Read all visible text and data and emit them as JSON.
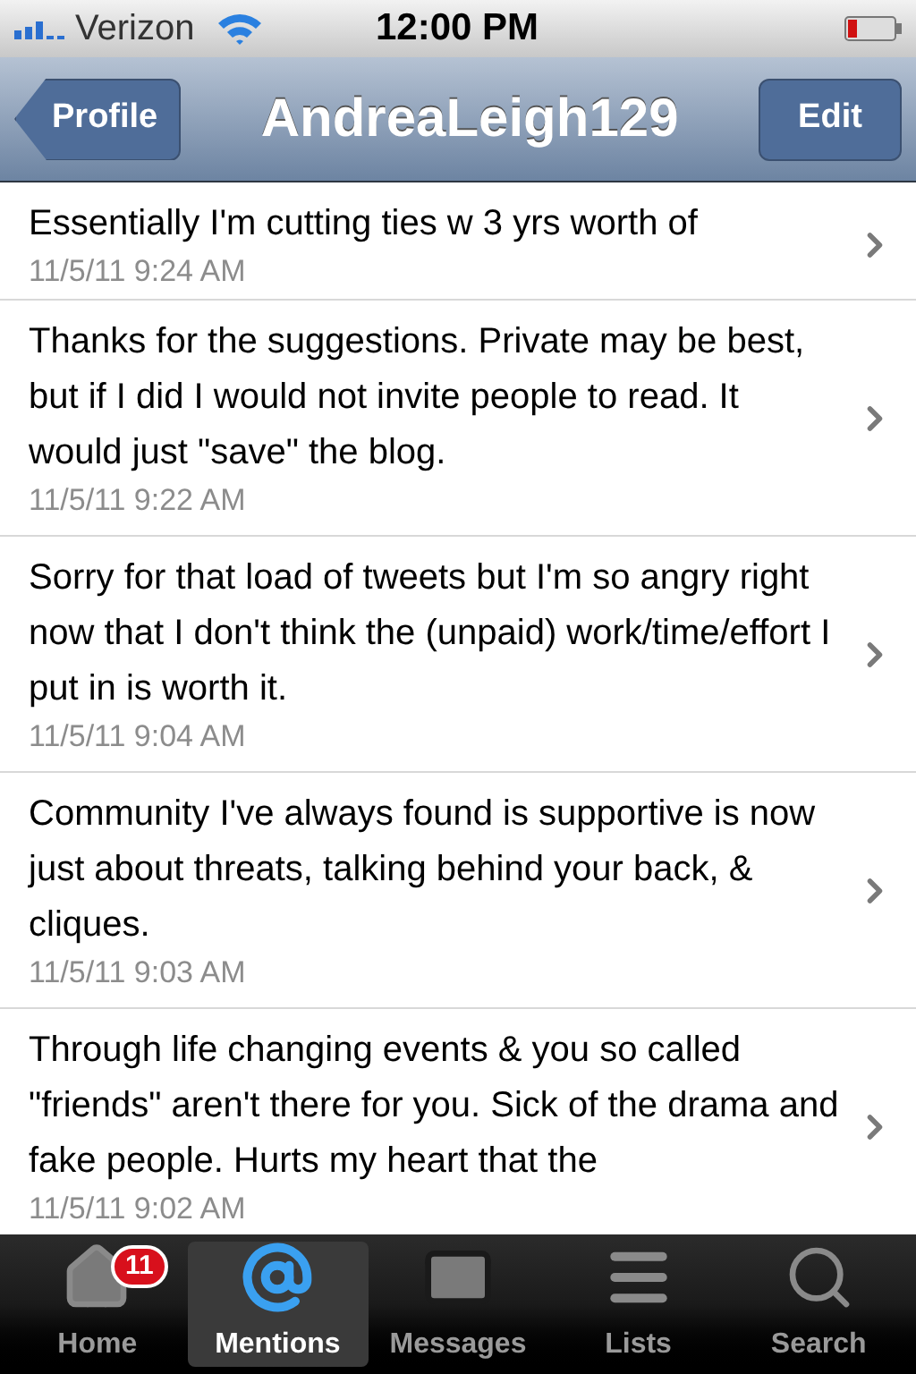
{
  "status_bar": {
    "carrier": "Verizon",
    "time": "12:00 PM"
  },
  "nav_bar": {
    "back_button": "Profile",
    "title": "AndreaLeigh129",
    "edit_button": "Edit"
  },
  "tweets": [
    {
      "text": "Essentially I'm cutting ties w 3 yrs worth of",
      "date": "11/5/11 9:24 AM"
    },
    {
      "text": "Thanks for the suggestions. Private may be best, but if I did I would not invite people to read. It would just \"save\" the blog.",
      "date": "11/5/11 9:22 AM"
    },
    {
      "text": "Sorry for that load of tweets but I'm so angry right now that I don't think the (unpaid) work/time/effort I put in is worth it.",
      "date": "11/5/11 9:04 AM"
    },
    {
      "text": "Community I've always found is supportive is now just about threats, talking behind your back, & cliques.",
      "date": "11/5/11 9:03 AM"
    },
    {
      "text": "Through life changing events & you so called \"friends\" aren't there for you. Sick of the drama and fake people. Hurts my heart that the",
      "date": "11/5/11 9:02 AM"
    }
  ],
  "tab_bar": [
    {
      "kind": "home",
      "label": "Home",
      "badge": "11",
      "selected": false
    },
    {
      "kind": "mentions",
      "label": "Mentions",
      "selected": true
    },
    {
      "kind": "messages",
      "label": "Messages",
      "selected": false
    },
    {
      "kind": "lists",
      "label": "Lists",
      "selected": false
    },
    {
      "kind": "search",
      "label": "Search",
      "selected": false
    }
  ]
}
